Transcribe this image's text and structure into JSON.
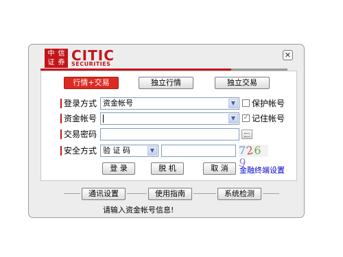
{
  "header": {
    "seal_chars": [
      "中",
      "信",
      "证",
      "券"
    ],
    "brand": "CITIC",
    "brand_sub": "SECURITIES",
    "close_glyph": "✕"
  },
  "mode_tabs": [
    {
      "label": "行情+交易",
      "active": true
    },
    {
      "label": "独立行情",
      "active": false
    },
    {
      "label": "独立交易",
      "active": false
    }
  ],
  "form": {
    "login_method": {
      "label": "登录方式",
      "value": "资金帐号"
    },
    "account": {
      "label": "资金帐号",
      "value": ""
    },
    "password": {
      "label": "交易密码",
      "value": ""
    },
    "security": {
      "label": "安全方式",
      "value": "验 证 码",
      "input": ""
    },
    "protect_account": {
      "label": "保护帐号",
      "checked": false
    },
    "remember_account": {
      "label": "记住帐号",
      "checked": true
    },
    "captcha": [
      "7",
      "2",
      "6",
      "9"
    ],
    "captcha_colors": [
      "#5b9bd5",
      "#c0504d",
      "#6aa84f",
      "#8e7cc3"
    ]
  },
  "actions": {
    "login": "登 录",
    "offline": "脱 机",
    "cancel": "取 消",
    "terminal_settings": "金融终端设置"
  },
  "footer": {
    "comm_settings": "通讯设置",
    "guide": "使用指南",
    "system_check": "系统检测"
  },
  "status": "请输入资金帐号信息!",
  "colors": {
    "brand_red": "#c4141a",
    "link_blue": "#0000cc"
  }
}
